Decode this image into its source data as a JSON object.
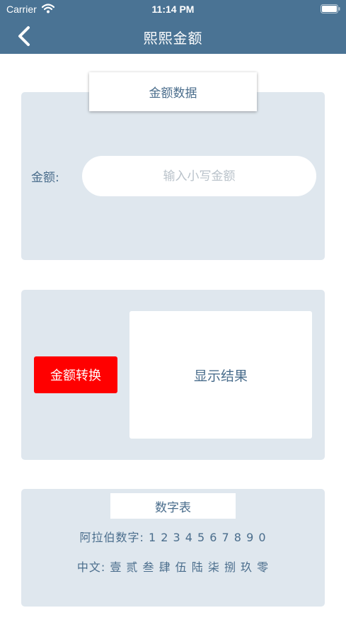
{
  "status_bar": {
    "carrier": "Carrier",
    "time": "11:14 PM"
  },
  "nav": {
    "title": "熙熙金额"
  },
  "amount_section": {
    "title": "金额数据",
    "label": "金额:",
    "input_value": "",
    "input_placeholder": "输入小写金额"
  },
  "convert_section": {
    "button_label": "金额转换",
    "result_text": "显示结果"
  },
  "number_table": {
    "title": "数字表",
    "arabic_line": "阿拉伯数字: 1 2 3 4 5 6 7 8 9 0",
    "chinese_line": "中文: 壹 贰 叁 肆 伍 陆 柒 捌 玖 零"
  },
  "colors": {
    "header": "#4a7394",
    "panel": "#dfe7ee",
    "text": "#4a6d8c",
    "convert_button": "#ff0000"
  },
  "icons": {
    "back": "chevron-left-icon",
    "wifi": "wifi-icon",
    "battery": "battery-icon"
  }
}
